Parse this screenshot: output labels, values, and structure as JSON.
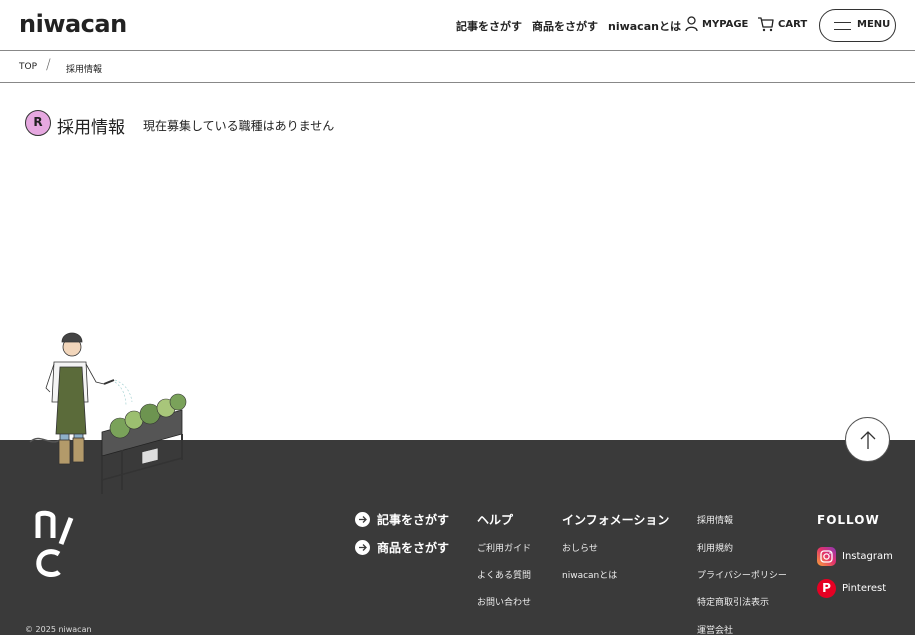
{
  "header": {
    "logo": "niwacan",
    "nav": {
      "search_articles": "記事をさがす",
      "search_products": "商品をさがす",
      "about": "niwacanとは",
      "mypage": "MYPAGE",
      "cart": "CART",
      "menu": "MENU"
    },
    "icons": {
      "mypage": "user-icon",
      "cart": "cart-icon",
      "menu": "hamburger-icon"
    }
  },
  "breadcrumb": {
    "top": "TOP",
    "separator": "/",
    "current": "採用情報"
  },
  "main": {
    "badge": "R",
    "title": "採用情報",
    "notice": "現在募集している職種はありません",
    "badge_color": "#e6a8e0"
  },
  "footer": {
    "background": "#3a3a3a",
    "search_links": [
      {
        "label": "記事をさがす"
      },
      {
        "label": "商品をさがす"
      }
    ],
    "help": {
      "heading": "ヘルプ",
      "items": [
        "ご利用ガイド",
        "よくある質問",
        "お問い合わせ"
      ]
    },
    "information": {
      "heading": "インフォメーション",
      "items": [
        "おしらせ",
        "niwacanとは"
      ]
    },
    "company": {
      "items": [
        "採用情報",
        "利用規約",
        "プライバシーポリシー",
        "特定商取引法表示",
        "運営会社"
      ]
    },
    "follow": {
      "heading": "FOLLOW",
      "instagram": "Instagram",
      "pinterest": "Pinterest"
    },
    "copyright": "© 2025 niwacan"
  }
}
